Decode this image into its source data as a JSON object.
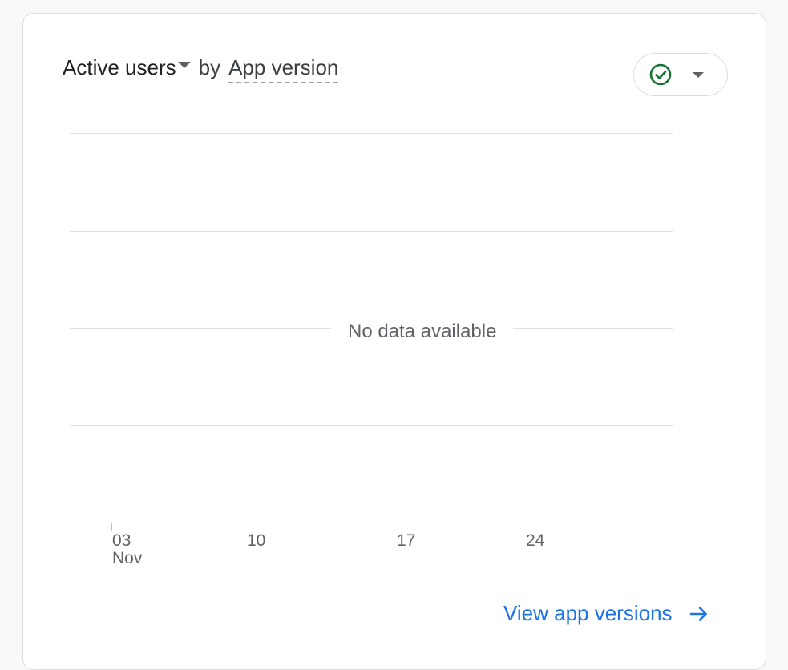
{
  "card": {
    "metric_label": "Active users",
    "by_label": "by",
    "dimension_label": "App version",
    "comparison_status_icon": "check-circle-icon",
    "no_data_text": "No data available",
    "x_axis": {
      "ticks": [
        {
          "day": "03",
          "month": "Nov"
        },
        {
          "day": "10",
          "month": ""
        },
        {
          "day": "17",
          "month": ""
        },
        {
          "day": "24",
          "month": ""
        }
      ]
    },
    "footer_link": "View app versions",
    "footer_icon": "arrow-forward-icon"
  },
  "colors": {
    "accent": "#1a73e8",
    "status_ok": "#137333",
    "text_primary": "#202124",
    "text_secondary": "#5f6368",
    "gridline": "#e0e0e0"
  }
}
